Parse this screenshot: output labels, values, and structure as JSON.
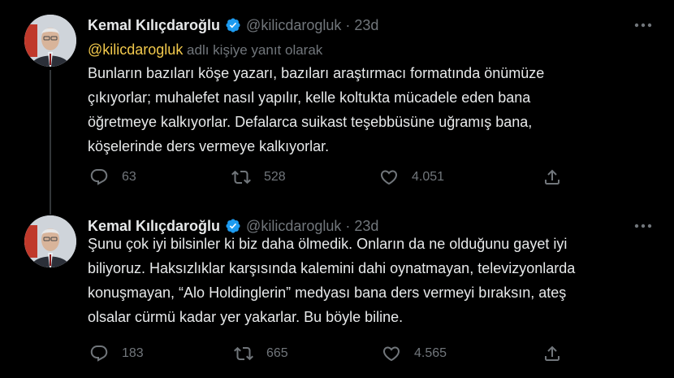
{
  "tweets": [
    {
      "author_name": "Kemal Kılıçdaroğlu",
      "handle": "@kilicdarogluk",
      "dot": "·",
      "time": "23d",
      "reply_mention": "@kilicdarogluk",
      "reply_suffix": " adlı kişiye yanıt olarak",
      "lines": [
        "Bunların bazıları köşe yazarı, bazıları araştırmacı formatında önümüze",
        "çıkıyorlar; muhalefet nasıl yapılır, kelle koltukta mücadele eden bana",
        "öğretmeye kalkıyorlar. Defalarca suikast teşebbüsüne uğramış bana,",
        "köşelerinde ders vermeye kalkıyorlar."
      ],
      "replies": "63",
      "retweets": "528",
      "likes": "4.051"
    },
    {
      "author_name": "Kemal Kılıçdaroğlu",
      "handle": "@kilicdarogluk",
      "dot": "·",
      "time": "23d",
      "lines": [
        "Şunu çok iyi bilsinler ki biz daha ölmedik. Onların da ne olduğunu gayet iyi",
        "biliyoruz. Haksızlıklar karşısında kalemini dahi oynatmayan, televizyonlarda",
        "konuşmayan, “Alo Holdinglerin” medyası bana ders vermeyi bıraksın, ateş",
        "olsalar cürmü kadar yer yakarlar. Bu böyle biline."
      ],
      "replies": "183",
      "retweets": "665",
      "likes": "4.565"
    }
  ],
  "icons": {
    "verified": "verified-badge-icon",
    "more": "more-icon",
    "reply": "reply-icon",
    "retweet": "retweet-icon",
    "like": "like-icon",
    "share": "share-icon"
  },
  "colors": {
    "background": "#000000",
    "text": "#e7e9ea",
    "secondary": "#71767b",
    "mention": "#f2c94c",
    "verified": "#1d9bf0",
    "thread_line": "#333639"
  }
}
